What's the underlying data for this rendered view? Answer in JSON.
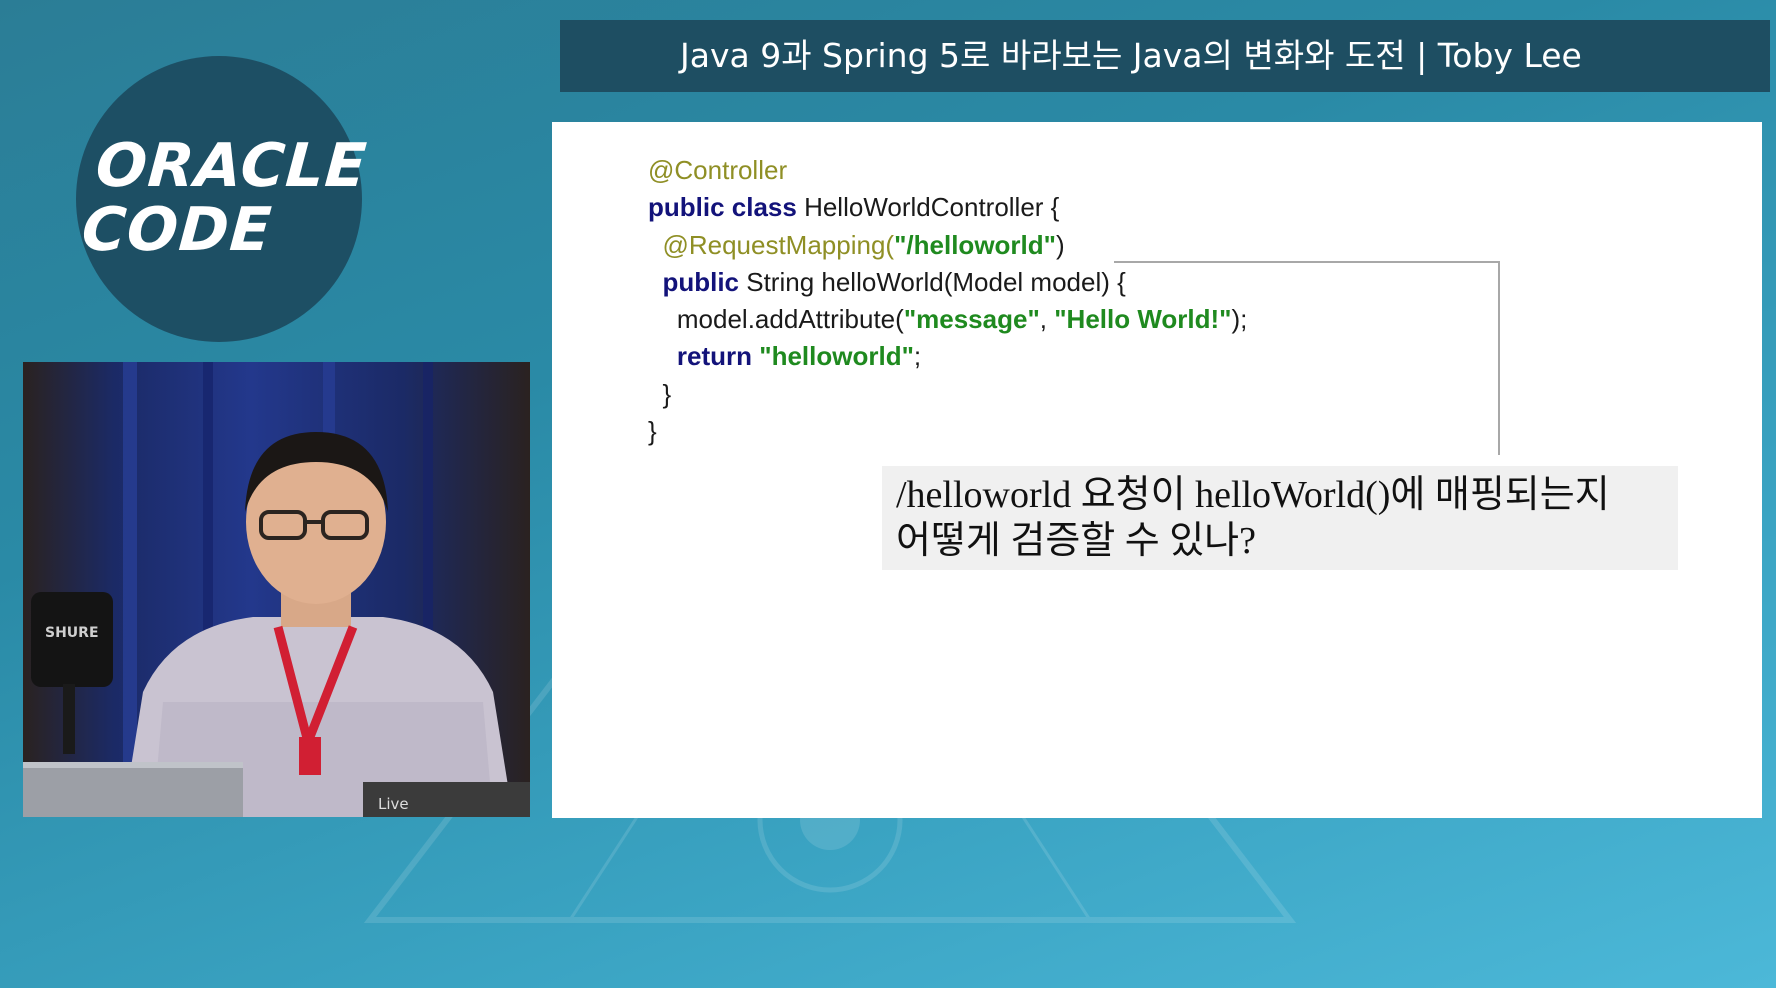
{
  "logo": {
    "line1": "ORACLE",
    "line2": "CODE"
  },
  "title_bar": {
    "text": "Java 9과 Spring 5로 바라보는 Java의 변화와 도전 | Toby Lee"
  },
  "slide": {
    "code_lines": [
      [
        {
          "t": "@Controller",
          "c": "ann"
        }
      ],
      [
        {
          "t": "public class",
          "c": "kw"
        },
        {
          "t": " HelloWorldController {",
          "c": ""
        }
      ],
      [
        {
          "t": "  ",
          "c": ""
        },
        {
          "t": "@RequestMapping(",
          "c": "ann"
        },
        {
          "t": "\"/helloworld\"",
          "c": "str"
        },
        {
          "t": ")",
          "c": ""
        }
      ],
      [
        {
          "t": "  ",
          "c": ""
        },
        {
          "t": "public",
          "c": "kw"
        },
        {
          "t": " String helloWorld(Model model) {",
          "c": ""
        }
      ],
      [
        {
          "t": "    model.addAttribute(",
          "c": ""
        },
        {
          "t": "\"message\"",
          "c": "str"
        },
        {
          "t": ", ",
          "c": ""
        },
        {
          "t": "\"Hello World!\"",
          "c": "str"
        },
        {
          "t": ");",
          "c": ""
        }
      ],
      [
        {
          "t": "    ",
          "c": ""
        },
        {
          "t": "return",
          "c": "kw"
        },
        {
          "t": " ",
          "c": ""
        },
        {
          "t": "\"helloworld\"",
          "c": "str"
        },
        {
          "t": ";",
          "c": ""
        }
      ],
      [
        {
          "t": "  }",
          "c": ""
        }
      ],
      [
        {
          "t": "}",
          "c": ""
        }
      ]
    ],
    "callout_lines": [
      "/helloworld 요청이 helloWorld()에 매핑되는지",
      "어떻게 검증할 수 있나?"
    ]
  },
  "video": {
    "mic_brand": "SHURE",
    "laptop_sticker": "Live"
  },
  "colors": {
    "annotation": "#8f8f25",
    "keyword": "#13137a",
    "string": "#1f8a1f",
    "title_bar_bg": "#1e4e62",
    "logo_bg": "#1d4f64"
  }
}
